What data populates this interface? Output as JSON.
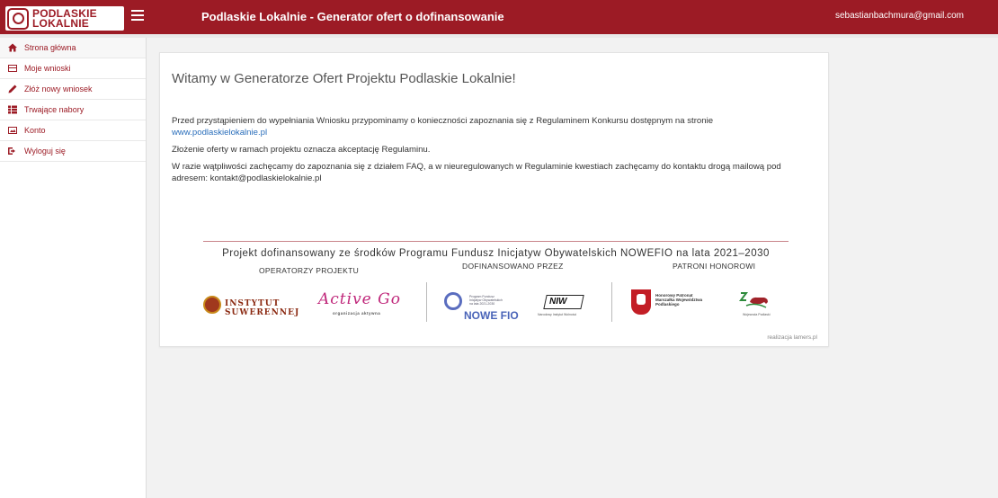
{
  "header": {
    "logo_line1": "PODLASKIE",
    "logo_line2": "LOKALNIE",
    "title": "Podlaskie Lokalnie - Generator ofert o dofinansowanie",
    "user_email": "sebastianbachmura@gmail.com",
    "bar_color": "#9c1b25"
  },
  "sidebar": {
    "items": [
      {
        "label": "Strona główna",
        "icon": "home-icon"
      },
      {
        "label": "Moje wnioski",
        "icon": "inbox-icon"
      },
      {
        "label": "Złóż nowy wniosek",
        "icon": "pencil-icon"
      },
      {
        "label": "Trwające nabory",
        "icon": "list-icon"
      },
      {
        "label": "Konto",
        "icon": "image-icon"
      },
      {
        "label": "Wyloguj się",
        "icon": "logout-icon"
      }
    ]
  },
  "main": {
    "welcome": "Witamy w Generatorze Ofert Projektu Podlaskie Lokalnie!",
    "p1_text": "Przed przystąpieniem do wypełniania Wniosku przypominamy o konieczności zapoznania się z Regulaminem Konkursu dostępnym na stronie",
    "p1_link": "www.podlaskielokalnie.pl",
    "p2": "Złożenie oferty w ramach projektu oznacza akceptację Regulaminu.",
    "p3": "W razie wątpliwości zachęcamy do zapoznania się z działem FAQ, a w nieuregulowanych w Regulaminie kwestiach zachęcamy do kontaktu drogą mailową pod adresem: kontakt@podlaskielokalnie.pl",
    "sponsor_title": "Projekt dofinansowany ze środków Programu Fundusz Inicjatyw Obywatelskich NOWEFIO na lata 2021–2030",
    "operators_title": "OPERATORZY PROJEKTU",
    "funded_title": "DOFINANSOWANO PRZEZ",
    "patrons_title": "PATRONI HONOROWI",
    "insty_line1": "INSTYTUT",
    "insty_line2": "SUWERENNEJ",
    "activego": "Active Go",
    "activego_sub": "organizacja aktywna",
    "fio_small": "Program Fundusz Inicjatyw Obywatelskich na lata 2021-2030",
    "fio_text": "NOWE FIO",
    "niw": "NIW",
    "niw_sub": "Narodowy Instytut Wolności",
    "herb_text": "Honorowy Patronat Marszałka Województwa Podlaskiego",
    "woj_sub": "Wojewoda Podlaski",
    "realizacja": "realizacja lamers.pl"
  }
}
